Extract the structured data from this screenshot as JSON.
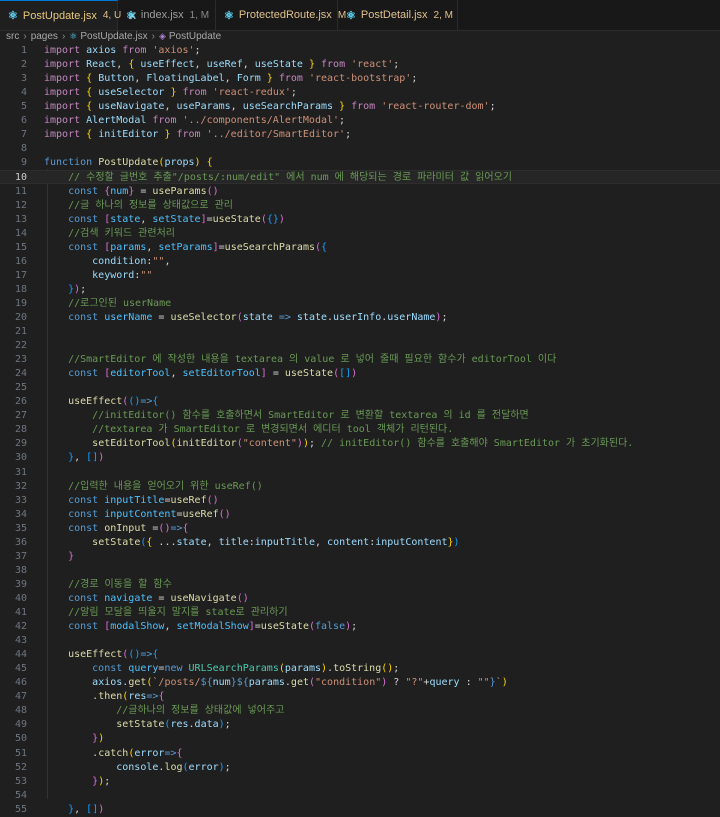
{
  "tabs": [
    {
      "name": "PostUpdate.jsx",
      "badge": "4, U",
      "icon": "react-icon",
      "active": true,
      "badge_color": "#e2c08d"
    },
    {
      "name": "index.jsx",
      "badge": "1, M",
      "icon": "react-icon",
      "active": false,
      "badge_color": "#8b8b8b"
    },
    {
      "name": "ProtectedRoute.jsx",
      "badge": "M",
      "icon": "react-icon",
      "active": false,
      "badge_color": "#e2c08d"
    },
    {
      "name": "PostDetail.jsx",
      "badge": "2, M",
      "icon": "react-icon",
      "active": false,
      "badge_color": "#e2c08d"
    }
  ],
  "close_glyph": "✕",
  "breadcrumb": [
    "src",
    "pages",
    "PostUpdate.jsx",
    "PostUpdate"
  ],
  "current_line": 10,
  "colors": {
    "keyword": "#569cd6",
    "control": "#c586c0",
    "variable": "#9cdcfe",
    "function": "#dcdcaa",
    "string": "#ce9178",
    "comment": "#6a9955",
    "text": "#d4d4d4",
    "bracket1": "#ffd700",
    "bracket2": "#da70d6",
    "bracket3": "#179fff",
    "const": "#4fc1ff",
    "type": "#4ec9b0",
    "number": "#b5cea8",
    "accent": "#0078d4"
  },
  "code": [
    [
      [
        "import ",
        "c"
      ],
      [
        "axios ",
        "v"
      ],
      [
        "from ",
        "c"
      ],
      [
        "'axios'",
        "s"
      ],
      [
        ";",
        "t"
      ]
    ],
    [
      [
        "import ",
        "c"
      ],
      [
        "React",
        "v"
      ],
      [
        ", ",
        "t"
      ],
      [
        "{ ",
        "b1"
      ],
      [
        "useEffect",
        "v"
      ],
      [
        ", ",
        "t"
      ],
      [
        "useRef",
        "v"
      ],
      [
        ", ",
        "t"
      ],
      [
        "useState ",
        "v"
      ],
      [
        "}",
        "b1"
      ],
      [
        " from ",
        "c"
      ],
      [
        "'react'",
        "s"
      ],
      [
        ";",
        "t"
      ]
    ],
    [
      [
        "import ",
        "c"
      ],
      [
        "{ ",
        "b1"
      ],
      [
        "Button",
        "v"
      ],
      [
        ", ",
        "t"
      ],
      [
        "FloatingLabel",
        "v"
      ],
      [
        ", ",
        "t"
      ],
      [
        "Form ",
        "v"
      ],
      [
        "}",
        "b1"
      ],
      [
        " from ",
        "c"
      ],
      [
        "'react-bootstrap'",
        "s"
      ],
      [
        ";",
        "t"
      ]
    ],
    [
      [
        "import ",
        "c"
      ],
      [
        "{ ",
        "b1"
      ],
      [
        "useSelector ",
        "v"
      ],
      [
        "}",
        "b1"
      ],
      [
        " from ",
        "c"
      ],
      [
        "'react-redux'",
        "s"
      ],
      [
        ";",
        "t"
      ]
    ],
    [
      [
        "import ",
        "c"
      ],
      [
        "{ ",
        "b1"
      ],
      [
        "useNavigate",
        "v"
      ],
      [
        ", ",
        "t"
      ],
      [
        "useParams",
        "v"
      ],
      [
        ", ",
        "t"
      ],
      [
        "useSearchParams ",
        "v"
      ],
      [
        "}",
        "b1"
      ],
      [
        " from ",
        "c"
      ],
      [
        "'react-router-dom'",
        "s"
      ],
      [
        ";",
        "t"
      ]
    ],
    [
      [
        "import ",
        "c"
      ],
      [
        "AlertModal ",
        "v"
      ],
      [
        "from ",
        "c"
      ],
      [
        "'../components/AlertModal'",
        "s"
      ],
      [
        ";",
        "t"
      ]
    ],
    [
      [
        "import ",
        "c"
      ],
      [
        "{ ",
        "b1"
      ],
      [
        "initEditor ",
        "v"
      ],
      [
        "}",
        "b1"
      ],
      [
        " from ",
        "c"
      ],
      [
        "'../editor/SmartEditor'",
        "s"
      ],
      [
        ";",
        "t"
      ]
    ],
    [],
    [
      [
        "function ",
        "k"
      ],
      [
        "PostUpdate",
        "f"
      ],
      [
        "(",
        "b1"
      ],
      [
        "props",
        "v"
      ],
      [
        ") ",
        "b1"
      ],
      [
        "{",
        "b1"
      ]
    ],
    [
      [
        "    // 수정할 글번호 추출\"/posts/:num/edit\" 에서 num 에 해당되는 경로 파라미터 값 읽어오기",
        "cm"
      ]
    ],
    [
      [
        "    const ",
        "k"
      ],
      [
        "{",
        "b2"
      ],
      [
        "num",
        "cn"
      ],
      [
        "}",
        "b2"
      ],
      [
        " = ",
        "t"
      ],
      [
        "useParams",
        "f"
      ],
      [
        "()",
        "b2"
      ]
    ],
    [
      [
        "    //글 하나의 정보를 상태값으로 관리",
        "cm"
      ]
    ],
    [
      [
        "    const ",
        "k"
      ],
      [
        "[",
        "b2"
      ],
      [
        "state",
        "cn"
      ],
      [
        ", ",
        "t"
      ],
      [
        "setState",
        "cn"
      ],
      [
        "]",
        "b2"
      ],
      [
        "=",
        "t"
      ],
      [
        "useState",
        "f"
      ],
      [
        "(",
        "b2"
      ],
      [
        "{}",
        "b3"
      ],
      [
        ")",
        "b2"
      ]
    ],
    [
      [
        "    //검색 키워드 관련처리",
        "cm"
      ]
    ],
    [
      [
        "    const ",
        "k"
      ],
      [
        "[",
        "b2"
      ],
      [
        "params",
        "cn"
      ],
      [
        ", ",
        "t"
      ],
      [
        "setParams",
        "cn"
      ],
      [
        "]",
        "b2"
      ],
      [
        "=",
        "t"
      ],
      [
        "useSearchParams",
        "f"
      ],
      [
        "(",
        "b2"
      ],
      [
        "{",
        "b3"
      ]
    ],
    [
      [
        "        condition",
        "v"
      ],
      [
        ":",
        "t"
      ],
      [
        "\"\"",
        "s"
      ],
      [
        ",",
        "t"
      ]
    ],
    [
      [
        "        keyword",
        "v"
      ],
      [
        ":",
        "t"
      ],
      [
        "\"\"",
        "s"
      ]
    ],
    [
      [
        "    ",
        "t"
      ],
      [
        "}",
        "b3"
      ],
      [
        ")",
        "b2"
      ],
      [
        ";",
        "t"
      ]
    ],
    [
      [
        "    //로그인된 userName",
        "cm"
      ]
    ],
    [
      [
        "    const ",
        "k"
      ],
      [
        "userName",
        "cn"
      ],
      [
        " = ",
        "t"
      ],
      [
        "useSelector",
        "f"
      ],
      [
        "(",
        "b2"
      ],
      [
        "state ",
        "v"
      ],
      [
        "=> ",
        "k"
      ],
      [
        "state",
        "v"
      ],
      [
        ".",
        "t"
      ],
      [
        "userInfo",
        "v"
      ],
      [
        ".",
        "t"
      ],
      [
        "userName",
        "v"
      ],
      [
        ")",
        "b2"
      ],
      [
        ";",
        "t"
      ]
    ],
    [],
    [],
    [
      [
        "    //SmartEditor 에 작성한 내용을 textarea 의 value 로 넣어 줄때 필요한 함수가 editorTool 이다",
        "cm"
      ]
    ],
    [
      [
        "    const ",
        "k"
      ],
      [
        "[",
        "b2"
      ],
      [
        "editorTool",
        "cn"
      ],
      [
        ", ",
        "t"
      ],
      [
        "setEditorTool",
        "cn"
      ],
      [
        "]",
        "b2"
      ],
      [
        " = ",
        "t"
      ],
      [
        "useState",
        "f"
      ],
      [
        "(",
        "b2"
      ],
      [
        "[]",
        "b3"
      ],
      [
        ")",
        "b2"
      ]
    ],
    [],
    [
      [
        "    ",
        "t"
      ],
      [
        "useEffect",
        "f"
      ],
      [
        "(",
        "b2"
      ],
      [
        "()",
        "b3"
      ],
      [
        "=>",
        "k"
      ],
      [
        "{",
        "b3"
      ]
    ],
    [
      [
        "        //initEditor() 함수를 호출하면서 SmartEditor 로 변환할 textarea 의 id 를 전달하면",
        "cm"
      ]
    ],
    [
      [
        "        //textarea 가 SmartEditor 로 변경되면서 에디터 tool 객체가 리턴된다.",
        "cm"
      ]
    ],
    [
      [
        "        ",
        "t"
      ],
      [
        "setEditorTool",
        "f"
      ],
      [
        "(",
        "b1"
      ],
      [
        "initEditor",
        "f"
      ],
      [
        "(",
        "b2"
      ],
      [
        "\"content\"",
        "s"
      ],
      [
        ")",
        "b2"
      ],
      [
        ")",
        "b1"
      ],
      [
        ";",
        "t"
      ],
      [
        " // initEditor() 함수를 호출해야 SmartEditor 가 초기화된다.",
        "cm"
      ]
    ],
    [
      [
        "    ",
        "t"
      ],
      [
        "}",
        "b3"
      ],
      [
        ", ",
        "t"
      ],
      [
        "[]",
        "b3"
      ],
      [
        ")",
        "b2"
      ]
    ],
    [],
    [
      [
        "    //입력한 내용을 얻어오기 위한 useRef()",
        "cm"
      ]
    ],
    [
      [
        "    const ",
        "k"
      ],
      [
        "inputTitle",
        "cn"
      ],
      [
        "=",
        "t"
      ],
      [
        "useRef",
        "f"
      ],
      [
        "()",
        "b2"
      ]
    ],
    [
      [
        "    const ",
        "k"
      ],
      [
        "inputContent",
        "cn"
      ],
      [
        "=",
        "t"
      ],
      [
        "useRef",
        "f"
      ],
      [
        "()",
        "b2"
      ]
    ],
    [
      [
        "    const ",
        "k"
      ],
      [
        "onInput ",
        "f"
      ],
      [
        "=",
        "t"
      ],
      [
        "()",
        "b2"
      ],
      [
        "=>",
        "k"
      ],
      [
        "{",
        "b2"
      ]
    ],
    [
      [
        "        ",
        "t"
      ],
      [
        "setState",
        "f"
      ],
      [
        "(",
        "b3"
      ],
      [
        "{ ",
        "b1"
      ],
      [
        "...",
        "t"
      ],
      [
        "state",
        "v"
      ],
      [
        ", ",
        "t"
      ],
      [
        "title",
        "v"
      ],
      [
        ":",
        "t"
      ],
      [
        "inputTitle",
        "v"
      ],
      [
        ", ",
        "t"
      ],
      [
        "content",
        "v"
      ],
      [
        ":",
        "t"
      ],
      [
        "inputContent",
        "v"
      ],
      [
        "}",
        "b1"
      ],
      [
        ")",
        "b3"
      ]
    ],
    [
      [
        "    ",
        "t"
      ],
      [
        "}",
        "b2"
      ]
    ],
    [],
    [
      [
        "    //경로 이동을 할 함수",
        "cm"
      ]
    ],
    [
      [
        "    const ",
        "k"
      ],
      [
        "navigate",
        "cn"
      ],
      [
        " = ",
        "t"
      ],
      [
        "useNavigate",
        "f"
      ],
      [
        "()",
        "b2"
      ]
    ],
    [
      [
        "    //알림 모달을 띄울지 말지를 state로 관리하기",
        "cm"
      ]
    ],
    [
      [
        "    const ",
        "k"
      ],
      [
        "[",
        "b2"
      ],
      [
        "modalShow",
        "cn"
      ],
      [
        ", ",
        "t"
      ],
      [
        "setModalShow",
        "cn"
      ],
      [
        "]",
        "b2"
      ],
      [
        "=",
        "t"
      ],
      [
        "useState",
        "f"
      ],
      [
        "(",
        "b2"
      ],
      [
        "false",
        "k"
      ],
      [
        ")",
        "b2"
      ],
      [
        ";",
        "t"
      ]
    ],
    [],
    [
      [
        "    ",
        "t"
      ],
      [
        "useEffect",
        "f"
      ],
      [
        "(",
        "b2"
      ],
      [
        "()",
        "b3"
      ],
      [
        "=>",
        "k"
      ],
      [
        "{",
        "b3"
      ]
    ],
    [
      [
        "        const ",
        "k"
      ],
      [
        "query",
        "cn"
      ],
      [
        "=",
        "t"
      ],
      [
        "new ",
        "k"
      ],
      [
        "URLSearchParams",
        "ty"
      ],
      [
        "(",
        "b1"
      ],
      [
        "params",
        "v"
      ],
      [
        ")",
        "b1"
      ],
      [
        ".",
        "t"
      ],
      [
        "toString",
        "f"
      ],
      [
        "()",
        "b1"
      ],
      [
        ";",
        "t"
      ]
    ],
    [
      [
        "        ",
        "t"
      ],
      [
        "axios",
        "v"
      ],
      [
        ".",
        "t"
      ],
      [
        "get",
        "f"
      ],
      [
        "(",
        "b1"
      ],
      [
        "`/posts/",
        "s"
      ],
      [
        "${",
        "k"
      ],
      [
        "num",
        "v"
      ],
      [
        "}",
        "k"
      ],
      [
        "${",
        "k"
      ],
      [
        "params",
        "v"
      ],
      [
        ".",
        "t"
      ],
      [
        "get",
        "f"
      ],
      [
        "(",
        "b2"
      ],
      [
        "\"condition\"",
        "s"
      ],
      [
        ")",
        "b2"
      ],
      [
        " ? ",
        "t"
      ],
      [
        "\"?\"",
        "s"
      ],
      [
        "+",
        "t"
      ],
      [
        "query",
        "v"
      ],
      [
        " : ",
        "t"
      ],
      [
        "\"\"",
        "s"
      ],
      [
        "}",
        "k"
      ],
      [
        "`",
        "s"
      ],
      [
        ")",
        "b1"
      ]
    ],
    [
      [
        "        ",
        "t"
      ],
      [
        ".",
        "t"
      ],
      [
        "then",
        "f"
      ],
      [
        "(",
        "b1"
      ],
      [
        "res",
        "v"
      ],
      [
        "=>",
        "k"
      ],
      [
        "{",
        "b2"
      ]
    ],
    [
      [
        "            //글하나의 정보를 상태값에 넣어주고",
        "cm"
      ]
    ],
    [
      [
        "            ",
        "t"
      ],
      [
        "setState",
        "f"
      ],
      [
        "(",
        "b3"
      ],
      [
        "res",
        "v"
      ],
      [
        ".",
        "t"
      ],
      [
        "data",
        "v"
      ],
      [
        ")",
        "b3"
      ],
      [
        ";",
        "t"
      ]
    ],
    [
      [
        "        ",
        "t"
      ],
      [
        "}",
        "b2"
      ],
      [
        ")",
        "b1"
      ]
    ],
    [
      [
        "        ",
        "t"
      ],
      [
        ".",
        "t"
      ],
      [
        "catch",
        "f"
      ],
      [
        "(",
        "b1"
      ],
      [
        "error",
        "v"
      ],
      [
        "=>",
        "k"
      ],
      [
        "{",
        "b2"
      ]
    ],
    [
      [
        "            ",
        "t"
      ],
      [
        "console",
        "v"
      ],
      [
        ".",
        "t"
      ],
      [
        "log",
        "f"
      ],
      [
        "(",
        "b3"
      ],
      [
        "error",
        "v"
      ],
      [
        ")",
        "b3"
      ],
      [
        ";",
        "t"
      ]
    ],
    [
      [
        "        ",
        "t"
      ],
      [
        "}",
        "b2"
      ],
      [
        ")",
        "b1"
      ],
      [
        ";",
        "t"
      ]
    ],
    [],
    [
      [
        "    ",
        "t"
      ],
      [
        "}",
        "b3"
      ],
      [
        ", ",
        "t"
      ],
      [
        "[]",
        "b3"
      ],
      [
        ")",
        "b2"
      ]
    ]
  ]
}
